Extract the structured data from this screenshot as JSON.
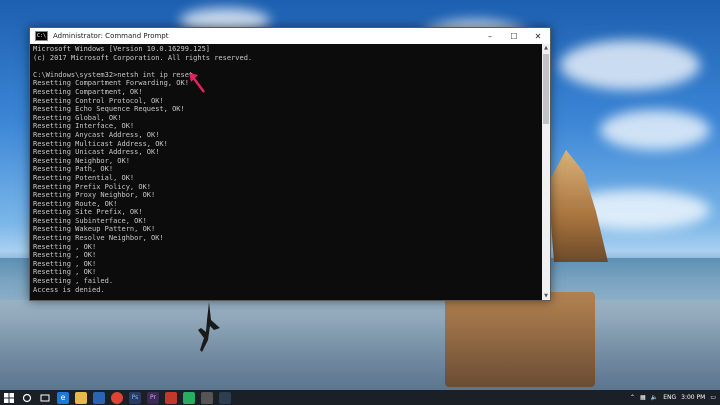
{
  "window": {
    "title": "Administrator: Command Prompt",
    "icon_label": "C:\\",
    "controls": [
      "–",
      "☐",
      "✕"
    ]
  },
  "console": {
    "lines": [
      "Microsoft Windows [Version 10.0.16299.125]",
      "(c) 2017 Microsoft Corporation. All rights reserved.",
      "",
      "C:\\Windows\\system32>netsh int ip reset",
      "Resetting Compartment Forwarding, OK!",
      "Resetting Compartment, OK!",
      "Resetting Control Protocol, OK!",
      "Resetting Echo Sequence Request, OK!",
      "Resetting Global, OK!",
      "Resetting Interface, OK!",
      "Resetting Anycast Address, OK!",
      "Resetting Multicast Address, OK!",
      "Resetting Unicast Address, OK!",
      "Resetting Neighbor, OK!",
      "Resetting Path, OK!",
      "Resetting Potential, OK!",
      "Resetting Prefix Policy, OK!",
      "Resetting Proxy Neighbor, OK!",
      "Resetting Route, OK!",
      "Resetting Site Prefix, OK!",
      "Resetting Subinterface, OK!",
      "Resetting Wakeup Pattern, OK!",
      "Resetting Resolve Neighbor, OK!",
      "Resetting , OK!",
      "Resetting , OK!",
      "Resetting , OK!",
      "Resetting , OK!",
      "Resetting , failed.",
      "Access is denied."
    ]
  },
  "taskbar": {
    "icons": [
      "windows-start-icon",
      "cortana-icon",
      "task-view-icon",
      "edge-icon",
      "file-explorer-icon",
      "store-icon",
      "chrome-icon",
      "photoshop-icon",
      "premiere-icon",
      "app-icon",
      "app-icon",
      "app-icon",
      "app-icon"
    ],
    "tray": {
      "language": "ENG",
      "time": "3:00 PM"
    }
  },
  "colors": {
    "console_bg": "#0c0c0c",
    "console_text": "#c8c8c8",
    "arrow": "#e0245e",
    "taskbar_bg": "#1b1f26"
  }
}
